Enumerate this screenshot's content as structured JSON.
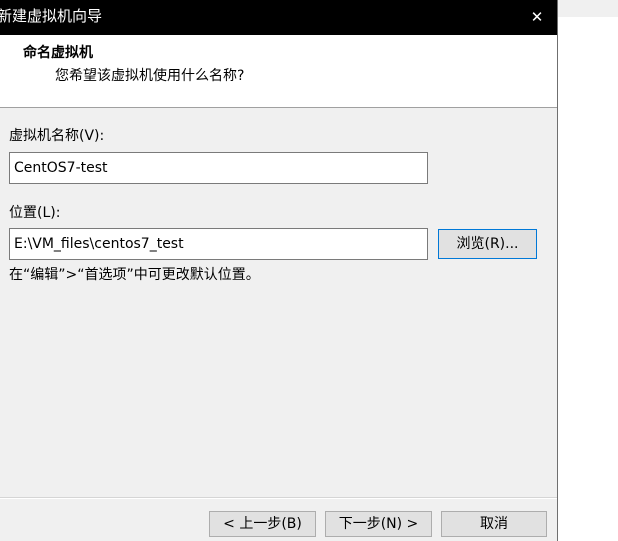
{
  "window": {
    "title": "新建虚拟机向导",
    "close_glyph": "✕"
  },
  "header": {
    "title": "命名虚拟机",
    "subtitle": "您希望该虚拟机使用什么名称?"
  },
  "form": {
    "name_label": "虚拟机名称(V):",
    "name_value": "CentOS7-test",
    "location_label": "位置(L):",
    "location_value": "E:\\VM_files\\centos7_test",
    "browse_label": "浏览(R)...",
    "hint": "在“编辑”>“首选项”中可更改默认位置。"
  },
  "footer": {
    "back_label": "< 上一步(B)",
    "next_label": "下一步(N) >",
    "cancel_label": "取消"
  },
  "icons": {
    "close": "close-icon"
  },
  "colors": {
    "titlebar_bg": "#000000",
    "titlebar_text": "#ffffff",
    "header_bg": "#ffffff",
    "dialog_bg": "#f0f0f0",
    "focus_border": "#0078d7"
  }
}
